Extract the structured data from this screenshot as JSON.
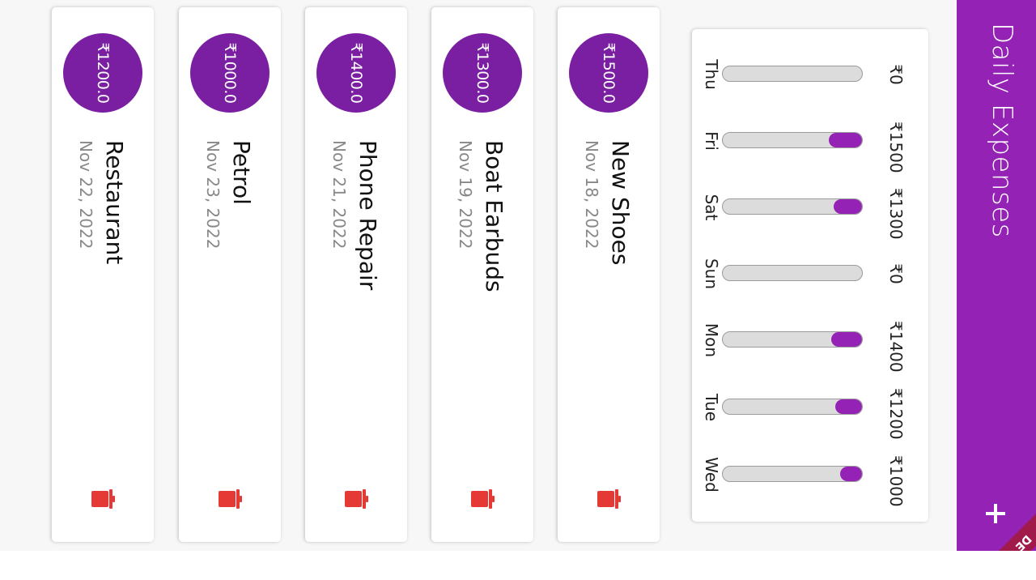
{
  "app_bar": {
    "title": "Daily Expenses",
    "add_icon": "plus-icon",
    "ribbon_text": "DE",
    "color": "#9422b4"
  },
  "chart_data": {
    "type": "bar",
    "categories": [
      "Thu",
      "Fri",
      "Sat",
      "Sun",
      "Mon",
      "Tue",
      "Wed"
    ],
    "values": [
      0,
      1500,
      1300,
      0,
      1400,
      1200,
      1000
    ],
    "value_labels": [
      "₹0",
      "₹1500",
      "₹1300",
      "₹0",
      "₹1400",
      "₹1200",
      "₹1000"
    ],
    "ylim": [
      0,
      6400
    ],
    "title": "",
    "xlabel": "",
    "ylabel": "",
    "grid": false,
    "bar_color": "#9422b4",
    "track_color": "#dcdcdc"
  },
  "transactions": [
    {
      "amount": "₹1500.0",
      "title": "New Shoes",
      "date": "Nov 18, 2022",
      "delete_icon": "trash-icon"
    },
    {
      "amount": "₹1300.0",
      "title": "Boat Earbuds",
      "date": "Nov 19, 2022",
      "delete_icon": "trash-icon"
    },
    {
      "amount": "₹1400.0",
      "title": "Phone Repair",
      "date": "Nov 21, 2022",
      "delete_icon": "trash-icon"
    },
    {
      "amount": "₹1000.0",
      "title": "Petrol",
      "date": "Nov 23, 2022",
      "delete_icon": "trash-icon"
    },
    {
      "amount": "₹1200.0",
      "title": "Restaurant",
      "date": "Nov 22, 2022",
      "delete_icon": "trash-icon"
    }
  ],
  "colors": {
    "accent": "#9422b4",
    "avatar": "#7b1fa2",
    "delete": "#e53935"
  }
}
